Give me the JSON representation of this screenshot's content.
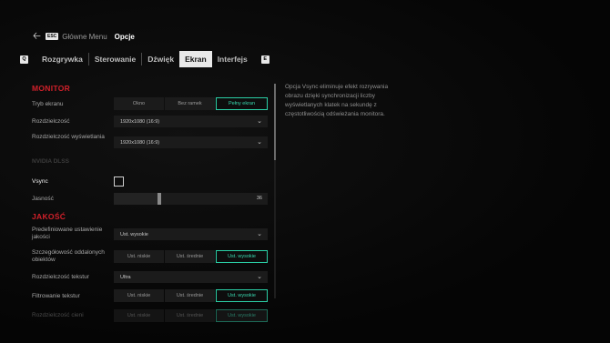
{
  "breadcrumb": {
    "esc_key": "ESC",
    "previous": "Główne Menu",
    "current": "Opcje"
  },
  "tabs": {
    "prev_key": "Q",
    "next_key": "E",
    "items": [
      {
        "label": "Rozgrywka"
      },
      {
        "label": "Sterowanie"
      },
      {
        "label": "Dźwięk"
      },
      {
        "label": "Ekran",
        "active": true
      },
      {
        "label": "Interfejs"
      }
    ]
  },
  "monitor": {
    "heading": "MONITOR",
    "screen_mode": {
      "label": "Tryb ekranu",
      "options": [
        "Okno",
        "Bez ramek",
        "Pełny ekran"
      ],
      "selected": "Pełny ekran"
    },
    "resolution": {
      "label": "Rozdzielczość",
      "value": "1920x1080 (16:9)"
    },
    "display_resolution": {
      "label": "Rozdzielczość wyświetlania",
      "value": "1920x1080 (16:9)"
    },
    "nvidia_dlss": {
      "label": "NVIDIA DLSS"
    },
    "vsync": {
      "label": "Vsync",
      "checked": false
    },
    "brightness": {
      "label": "Jasność",
      "value": "36"
    }
  },
  "quality": {
    "heading": "JAKOŚĆ",
    "preset": {
      "label": "Predefiniowane ustawienie jakości",
      "value": "Ust. wysokie"
    },
    "distant_detail": {
      "label": "Szczegółowość oddalonych obiektów",
      "options": [
        "Ust. niskie",
        "Ust. średnie",
        "Ust. wysokie"
      ],
      "selected": "Ust. wysokie"
    },
    "texture_resolution": {
      "label": "Rozdzielczość tekstur",
      "value": "Ultra"
    },
    "texture_filtering": {
      "label": "Filtrowanie tekstur",
      "options": [
        "Ust. niskie",
        "Ust. średnie",
        "Ust. wysokie"
      ],
      "selected": "Ust. wysokie"
    },
    "shadow_resolution": {
      "label": "Rozdzielczość cieni",
      "options": [
        "Ust. niskie",
        "Ust. średnie",
        "Ust. wysokie"
      ],
      "selected": "Ust. wysokie"
    }
  },
  "description": "Opcja Vsync eliminuje efekt rozrywania obrazu dzięki synchronizacji liczby wyświetlanych klatek na sekundę z częstotliwością odświeżania monitora.",
  "colors": {
    "accent_red": "#d0202a",
    "selected_teal": "#2bd0a6"
  }
}
